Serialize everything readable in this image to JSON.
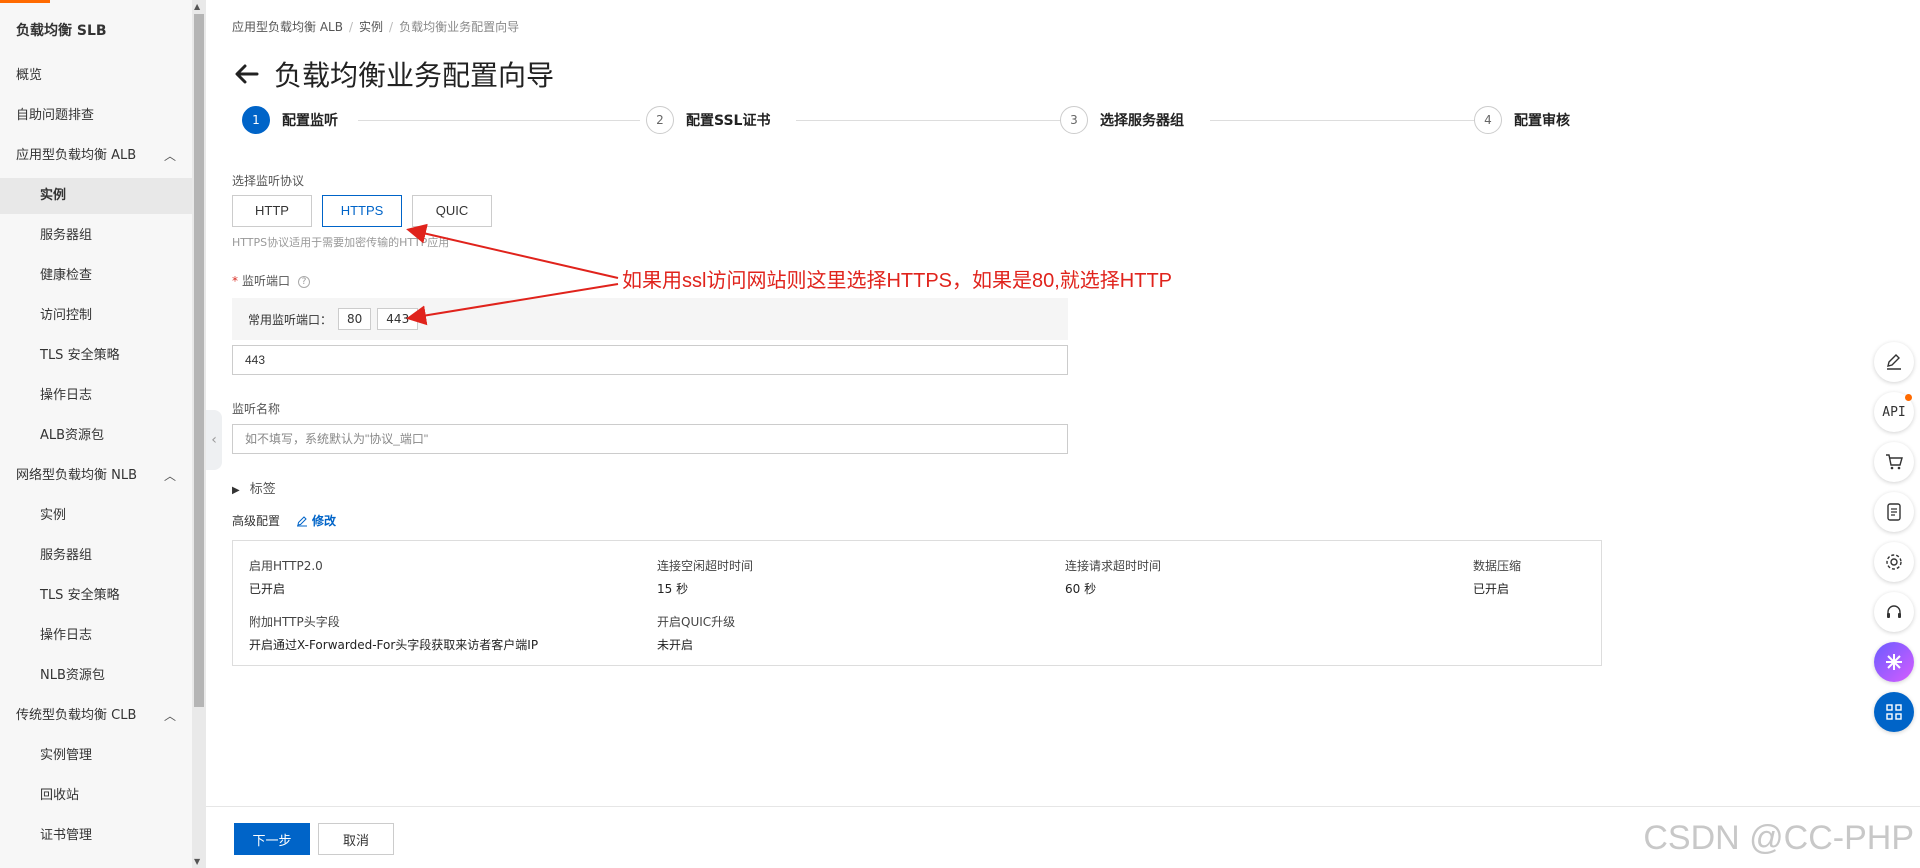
{
  "sidebar": {
    "title": "负载均衡 SLB",
    "items": [
      {
        "label": "概览",
        "level": 1
      },
      {
        "label": "自助问题排查",
        "level": 1
      },
      {
        "label": "应用型负载均衡 ALB",
        "level": 1,
        "expanded": true
      },
      {
        "label": "实例",
        "level": 2,
        "active": true
      },
      {
        "label": "服务器组",
        "level": 2
      },
      {
        "label": "健康检查",
        "level": 2
      },
      {
        "label": "访问控制",
        "level": 2
      },
      {
        "label": "TLS 安全策略",
        "level": 2
      },
      {
        "label": "操作日志",
        "level": 2
      },
      {
        "label": "ALB资源包",
        "level": 2
      },
      {
        "label": "网络型负载均衡 NLB",
        "level": 1,
        "expanded": true
      },
      {
        "label": "实例",
        "level": 2
      },
      {
        "label": "服务器组",
        "level": 2
      },
      {
        "label": "TLS 安全策略",
        "level": 2
      },
      {
        "label": "操作日志",
        "level": 2
      },
      {
        "label": "NLB资源包",
        "level": 2
      },
      {
        "label": "传统型负载均衡 CLB",
        "level": 1,
        "expanded": true
      },
      {
        "label": "实例管理",
        "level": 2
      },
      {
        "label": "回收站",
        "level": 2
      },
      {
        "label": "证书管理",
        "level": 2
      }
    ]
  },
  "breadcrumb": [
    "应用型负载均衡 ALB",
    "实例",
    "负载均衡业务配置向导"
  ],
  "page_title": "负载均衡业务配置向导",
  "steps": [
    {
      "num": "1",
      "label": "配置监听",
      "active": true
    },
    {
      "num": "2",
      "label": "配置SSL证书"
    },
    {
      "num": "3",
      "label": "选择服务器组"
    },
    {
      "num": "4",
      "label": "配置审核"
    }
  ],
  "protocol": {
    "label": "选择监听协议",
    "options": [
      "HTTP",
      "HTTPS",
      "QUIC"
    ],
    "selected": "HTTPS",
    "hint": "HTTPS协议适用于需要加密传输的HTTP应用"
  },
  "port": {
    "required": "*",
    "label": "监听端口",
    "help": "?",
    "common_label": "常用监听端口：",
    "common": [
      "80",
      "443"
    ],
    "value": "443"
  },
  "listener_name": {
    "label": "监听名称",
    "placeholder": "如不填写，系统默认为\"协议_端口\""
  },
  "tags_label": "标签",
  "advanced": {
    "label": "高级配置",
    "edit_label": "修改",
    "fields": [
      {
        "key": "启用HTTP2.0",
        "value": "已开启"
      },
      {
        "key": "连接空闲超时时间",
        "value": "15 秒"
      },
      {
        "key": "连接请求超时时间",
        "value": "60 秒"
      },
      {
        "key": "数据压缩",
        "value": "已开启"
      },
      {
        "key": "附加HTTP头字段",
        "value": "开启通过X-Forwarded-For头字段获取来访者客户端IP"
      },
      {
        "key": "开启QUIC升级",
        "value": "未开启"
      }
    ]
  },
  "footer": {
    "next": "下一步",
    "cancel": "取消"
  },
  "float_tools": [
    "edit-icon",
    "api-icon",
    "cart-icon",
    "doc-icon",
    "settings-icon",
    "headset-icon",
    "ai-assistant-icon",
    "apps-icon"
  ],
  "api_text": "API",
  "annotation": "如果用ssl访问网站则这里选择HTTPS，如果是80,就选择HTTP",
  "watermark": "CSDN @CC-PHP",
  "colors": {
    "primary": "#0064c8",
    "annotation": "#e0231c",
    "brand": "#ff6a00"
  }
}
